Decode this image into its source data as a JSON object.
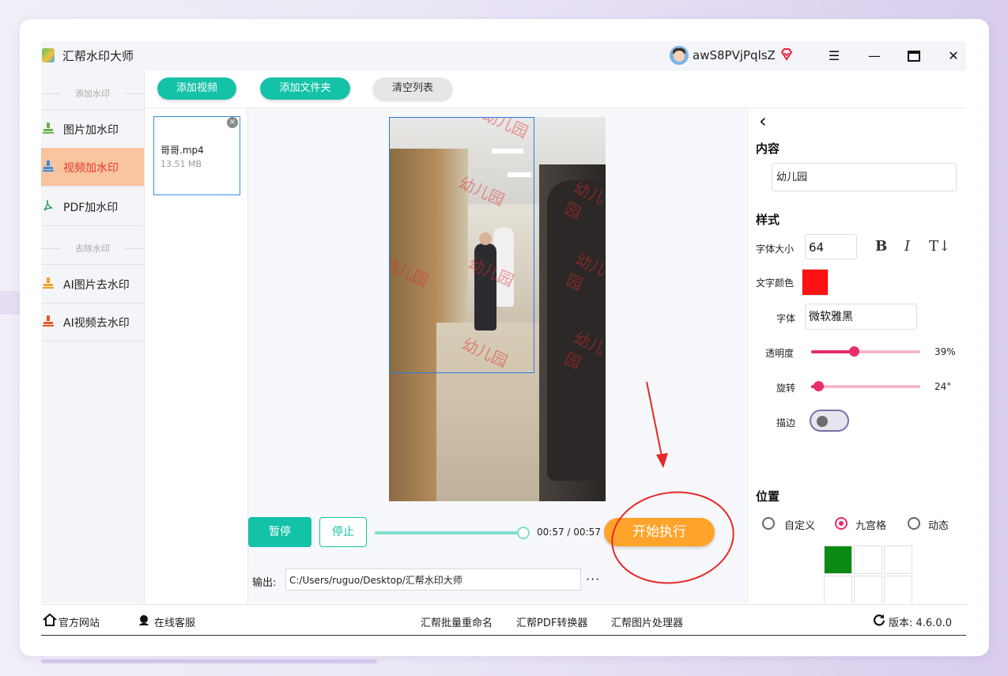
{
  "app": {
    "title": "汇帮水印大师",
    "username": "awS8PVjPqlsZ"
  },
  "sidebar": {
    "section_add": "添加水印",
    "section_remove": "去除水印",
    "items": [
      {
        "label": "图片加水印",
        "active": false
      },
      {
        "label": "视频加水印",
        "active": true
      },
      {
        "label": "PDF加水印",
        "active": false
      },
      {
        "label": "AI图片去水印",
        "active": false
      },
      {
        "label": "AI视频去水印",
        "active": false
      }
    ]
  },
  "toolbar": {
    "add_video": "添加视频",
    "add_folder": "添加文件夹",
    "clear_list": "清空列表"
  },
  "files": [
    {
      "name": "哥哥.mp4",
      "size": "13.51 MB",
      "remove": "×"
    }
  ],
  "preview": {
    "watermark_text": "幼儿园"
  },
  "player": {
    "pause": "暂停",
    "stop": "停止",
    "progress": 1.0,
    "time": "00:57 / 00:57",
    "start": "开始执行"
  },
  "output": {
    "label": "输出:",
    "path": "C:/Users/ruguo/Desktop/汇帮水印大师",
    "more": "···"
  },
  "settings": {
    "back": "‹",
    "content_heading": "内容",
    "content_value": "幼儿园",
    "style_heading": "样式",
    "font_size_label": "字体大小",
    "font_size": "64",
    "bold": "B",
    "italic": "I",
    "text_dir": "T↓",
    "color_label": "文字颜色",
    "color_value": "#ff1111",
    "font_label": "字体",
    "font_value": "微软雅黑",
    "opacity_label": "透明度",
    "opacity_value": "39%",
    "opacity": 0.39,
    "rotation_label": "旋转",
    "rotation_value": "24°",
    "rotation": 0.067,
    "stroke_label": "描边",
    "stroke_on": false,
    "position_heading": "位置",
    "position_options": [
      "自定义",
      "九宫格",
      "动态"
    ],
    "position_selected": "九宫格"
  },
  "footer": {
    "website": "官方网站",
    "support": "在线客服",
    "links": [
      "汇帮批量重命名",
      "汇帮PDF转换器",
      "汇帮图片处理器"
    ],
    "version": "版本: 4.6.0.0"
  }
}
